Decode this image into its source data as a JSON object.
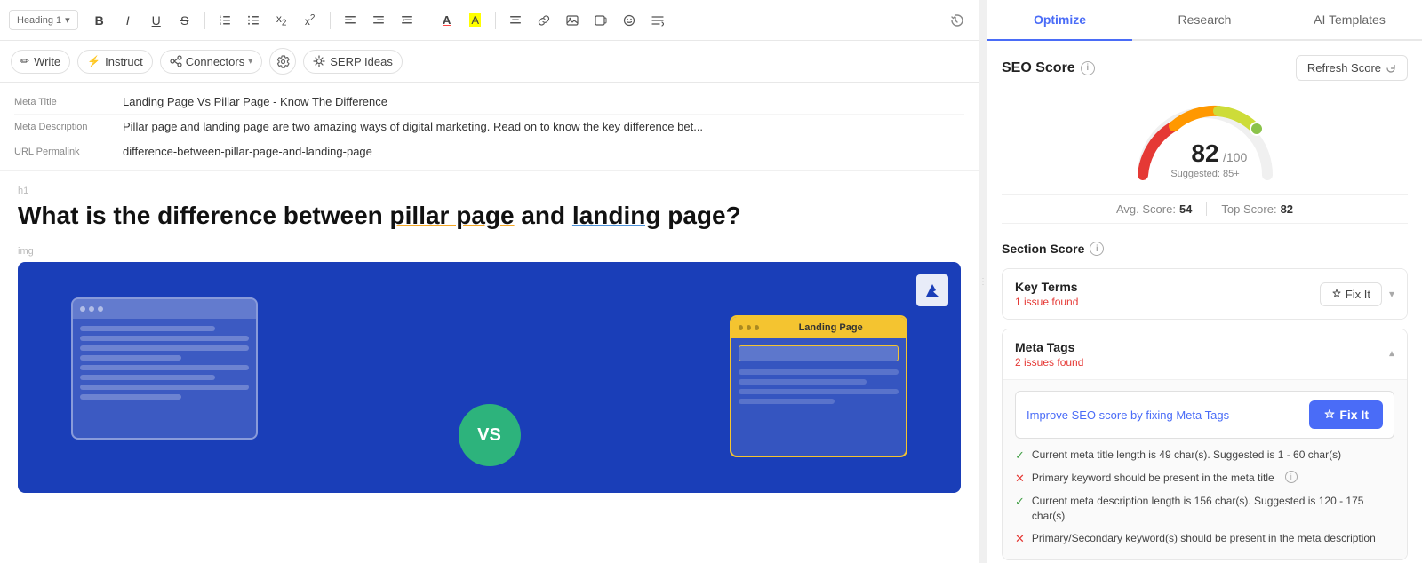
{
  "toolbar": {
    "heading_label": "Heading 1",
    "dropdown_arrow": "▾",
    "bold": "B",
    "italic": "I",
    "underline": "U",
    "strikethrough": "S",
    "ordered_list": "≡",
    "unordered_list": "≡",
    "sub": "x₂",
    "sup": "x²",
    "align_left": "≡",
    "align_right": "≡",
    "indent": "⇥",
    "text_color": "A",
    "highlight": "A",
    "align_center": "≡",
    "link": "🔗",
    "image": "⬜",
    "media": "⬜",
    "emoji": "☺",
    "more": "⋯",
    "history": "↺"
  },
  "sub_toolbar": {
    "write_label": "Write",
    "write_icon": "✏",
    "instruct_label": "Instruct",
    "instruct_icon": "⚡",
    "connectors_label": "Connectors",
    "connectors_arrow": "▾",
    "settings_icon": "⚙",
    "serp_label": "SERP Ideas",
    "serp_icon": "🔄"
  },
  "meta": {
    "title_label": "Meta Title",
    "title_value": "Landing Page Vs Pillar Page - Know The Difference",
    "description_label": "Meta Description",
    "description_value": "Pillar page and landing page are two amazing ways of digital marketing. Read on to know the key difference bet...",
    "permalink_label": "URL Permalink",
    "permalink_value": "difference-between-pillar-page-and-landing-page"
  },
  "article": {
    "h1_label": "h1",
    "title_part1": "What is the difference between ",
    "title_highlight1": "pillar page",
    "title_middle": " and ",
    "title_highlight2": "landing",
    "title_part2": "page?",
    "img_label": "img",
    "image_alt": "Landing Page VS Pillar Page comparison image",
    "vs_text": "VS",
    "landing_page_text": "Landing Page",
    "logo_text": "■"
  },
  "seo_panel": {
    "tabs": [
      {
        "id": "optimize",
        "label": "Optimize",
        "active": true
      },
      {
        "id": "research",
        "label": "Research",
        "active": false
      },
      {
        "id": "ai_templates",
        "label": "AI Templates",
        "active": false
      }
    ],
    "score_section": {
      "title": "SEO Score",
      "refresh_btn": "Refresh Score",
      "refresh_icon": "↗",
      "score": "82",
      "score_max": "/100",
      "suggested_label": "Suggested: 85+",
      "avg_label": "Avg. Score:",
      "avg_value": "54",
      "top_label": "Top Score:",
      "top_value": "82"
    },
    "section_score": {
      "title": "Section Score"
    },
    "key_terms": {
      "title": "Key Terms",
      "subtitle": "1 issue found",
      "fix_it_label": "Fix It",
      "fix_icon": "✦"
    },
    "meta_tags": {
      "title": "Meta Tags",
      "subtitle": "2 issues found",
      "fix_it_label": "Fix It",
      "fix_icon": "✦",
      "suggestion_text": "Improve SEO score by fixing Meta Tags",
      "checks": [
        {
          "ok": true,
          "text": "Current meta title length is 49 char(s). Suggested is 1 - 60 char(s)"
        },
        {
          "ok": false,
          "text": "Primary keyword should be present in the meta title",
          "has_info": true
        },
        {
          "ok": true,
          "text": "Current meta description length is 156 char(s). Suggested is 120 - 175 char(s)"
        },
        {
          "ok": false,
          "text": "Primary/Secondary keyword(s) should be present in the meta description"
        }
      ]
    }
  }
}
